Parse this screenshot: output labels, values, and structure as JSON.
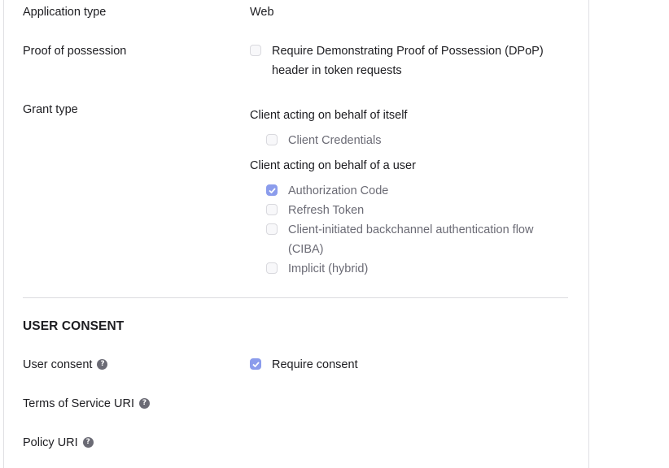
{
  "application_type": {
    "label": "Application type",
    "value": "Web"
  },
  "proof_of_possession": {
    "label": "Proof of possession",
    "option_line1": "Require Demonstrating Proof of Possession (DPoP)",
    "option_line2": "header in token requests",
    "checked": false
  },
  "grant_type": {
    "label": "Grant type",
    "group_self": "Client acting on behalf of itself",
    "client_credentials": "Client Credentials",
    "group_user": "Client acting on behalf of a user",
    "authorization_code": "Authorization Code",
    "refresh_token": "Refresh Token",
    "ciba_line1": "Client-initiated backchannel authentication flow",
    "ciba_line2": "(CIBA)",
    "implicit": "Implicit (hybrid)"
  },
  "user_consent_section": {
    "title": "USER CONSENT",
    "user_consent_label": "User consent",
    "require_consent": "Require consent",
    "tos_label": "Terms of Service URI",
    "policy_label": "Policy URI",
    "help_glyph": "?"
  },
  "colors": {
    "accent": "#8b9cec",
    "text": "#1d1d21",
    "muted": "#6b6b75"
  }
}
